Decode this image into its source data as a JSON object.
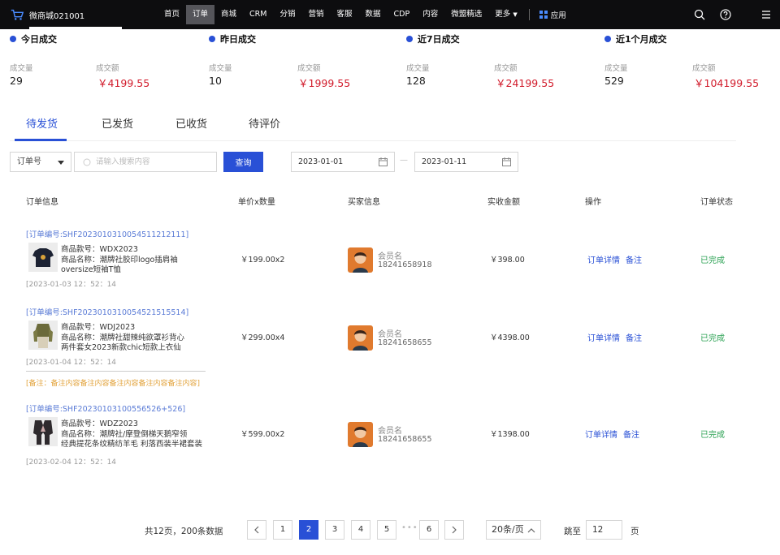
{
  "app": {
    "store_name": "微商城021001"
  },
  "nav": {
    "items": [
      "首页",
      "订单",
      "商城",
      "CRM",
      "分销",
      "营销",
      "客服",
      "数据",
      "CDP",
      "内容",
      "微盟精选",
      "更多"
    ],
    "active": "订单",
    "apps_label": "应用"
  },
  "stats": [
    {
      "title": "今日成交",
      "count_label": "成交量",
      "count": "29",
      "amount_label": "成交额",
      "amount": "￥4199.55"
    },
    {
      "title": "昨日成交",
      "count_label": "成交量",
      "count": "10",
      "amount_label": "成交额",
      "amount": "￥1999.55"
    },
    {
      "title": "近7日成交",
      "count_label": "成交量",
      "count": "128",
      "amount_label": "成交额",
      "amount": "￥24199.55"
    },
    {
      "title": "近1个月成交",
      "count_label": "成交量",
      "count": "529",
      "amount_label": "成交额",
      "amount": "￥104199.55"
    }
  ],
  "tabs": [
    "待发货",
    "已发货",
    "已收货",
    "待评价"
  ],
  "filter": {
    "select_value": "订单号",
    "search_placeholder": "请输入搜索内容",
    "query_label": "查询",
    "date_start": "2023-01-01",
    "date_sep": "—",
    "date_end": "2023-01-11"
  },
  "table": {
    "headers": [
      "订单信息",
      "单价x数量",
      "买家信息",
      "实收金额",
      "操作",
      "订单状态"
    ],
    "rows": [
      {
        "order_no": "[订单编号:SHF2023010310054511212111]",
        "product_code": "商品款号：WDX2023",
        "product_name_1": "商品名称：潮牌社胶印logo插肩袖",
        "product_name_2": "oversize短袖T恤",
        "time": "[2023-01-03  12：52：14",
        "price_qty": "￥199.00x2",
        "buyer_name": "会员名",
        "buyer_phone": "18241658918",
        "amount": "￥398.00",
        "op_detail": "订单详情",
        "op_note": "备注",
        "status": "已完成"
      },
      {
        "order_no": "[订单编号:SHF2023010310054521515514]",
        "product_code": "商品款号：WDJ2023",
        "product_name_1": "商品名称：潮牌社甜辣纯欲罩衫背心",
        "product_name_2": "两件套女2023新款chic短款上衣仙",
        "time": "[2023-01-04  12：52：14",
        "price_qty": "￥299.00x4",
        "buyer_name": "会员名",
        "buyer_phone": "18241658655",
        "amount": "￥4398.00",
        "op_detail": "订单详情",
        "op_note": "备注",
        "status": "已完成",
        "remark": "[备注：备注内容备注内容备注内容备注内容备注内容]"
      },
      {
        "order_no": "[订单编号:SHF202301031005565​26+526]",
        "product_code": "商品款号：WDZ2023",
        "product_name_1": "商品名称：潮牌社/摩登倒梯天鹅窄领",
        "product_name_2": "经典提花条纹精纺羊毛 利落西装半裙套装",
        "time": "[2023-02-04  12：52：14",
        "price_qty": "￥599.00x2",
        "buyer_name": "会员名",
        "buyer_phone": "18241658655",
        "amount": "￥1398.00",
        "op_detail": "订单详情",
        "op_note": "备注",
        "status": "已完成"
      }
    ]
  },
  "pagination": {
    "total_text": "共12页，200条数据",
    "pages": [
      "1",
      "2",
      "3",
      "4",
      "5",
      "6"
    ],
    "current": "2",
    "ellipsis": "•••",
    "page_size": "20条/页",
    "jump_label": "跳至",
    "jump_value": "12",
    "page_suffix": "页"
  },
  "colors": {
    "accent": "#2950d6",
    "amount_red": "#d11a2a",
    "status_green": "#2aa152",
    "remark_orange": "#e3a540",
    "topbar": "#0d0d0f"
  }
}
